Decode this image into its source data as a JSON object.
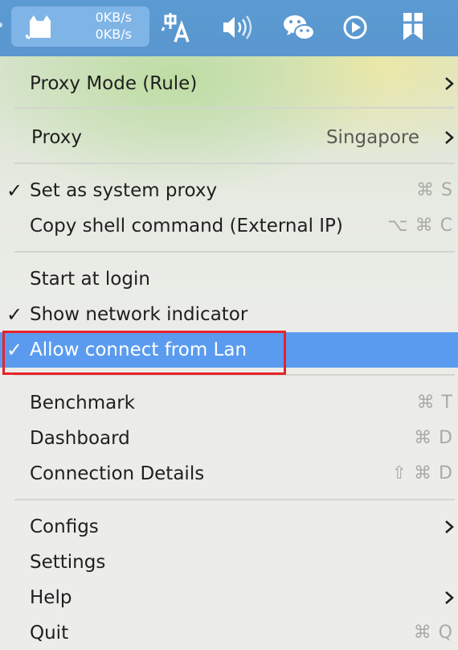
{
  "menubar": {
    "upload_speed": "0KB/s",
    "download_speed": "0KB/s",
    "icons": [
      "clash-cat-icon",
      "translate-icon",
      "volume-icon",
      "wechat-icon",
      "play-icon",
      "bookmark-icon"
    ]
  },
  "menu": {
    "proxy_mode": {
      "label": "Proxy Mode (Rule)"
    },
    "proxy": {
      "label": "Proxy",
      "value": "Singapore"
    },
    "set_system_proxy": {
      "label": "Set as system proxy",
      "shortcut": "⌘ S",
      "checked": true
    },
    "copy_shell": {
      "label": "Copy shell command (External IP)",
      "shortcut": "⌥ ⌘ C"
    },
    "start_at_login": {
      "label": "Start at login",
      "checked": false
    },
    "show_network_indicator": {
      "label": "Show network indicator",
      "checked": true
    },
    "allow_lan": {
      "label": "Allow connect from Lan",
      "checked": true,
      "selected": true
    },
    "benchmark": {
      "label": "Benchmark",
      "shortcut": "⌘ T"
    },
    "dashboard": {
      "label": "Dashboard",
      "shortcut": "⌘ D"
    },
    "connection_details": {
      "label": "Connection Details",
      "shortcut": "⇧ ⌘ D"
    },
    "configs": {
      "label": "Configs"
    },
    "settings": {
      "label": "Settings"
    },
    "help": {
      "label": "Help"
    },
    "quit": {
      "label": "Quit",
      "shortcut": "⌘ Q"
    }
  },
  "check_mark": "✓",
  "colors": {
    "menubar": "#5a96cf",
    "selected_row": "#5a9bef",
    "annotation_box": "#e8232a",
    "shortcut_text": "#a9aaa6"
  }
}
